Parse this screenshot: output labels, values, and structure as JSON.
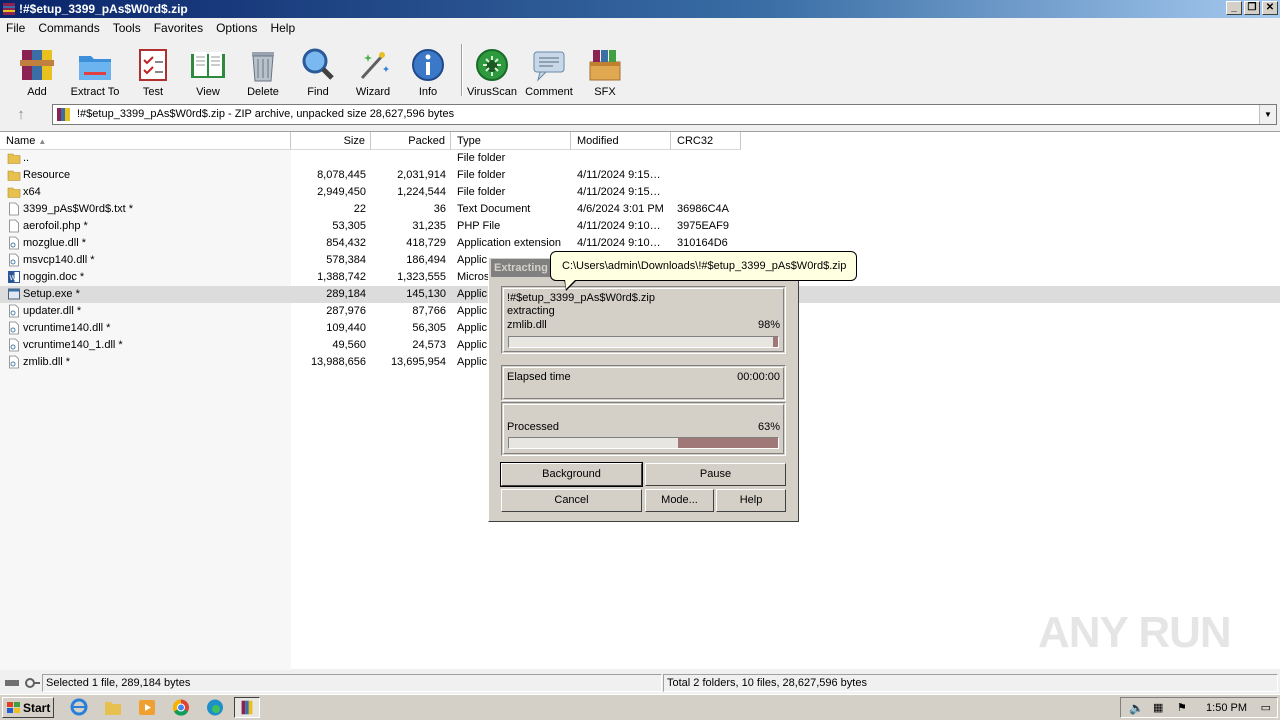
{
  "window": {
    "title": "!#$etup_3399_pAs$W0rd$.zip",
    "controls": [
      "_",
      "❐",
      "✕"
    ]
  },
  "menu": [
    "File",
    "Commands",
    "Tools",
    "Favorites",
    "Options",
    "Help"
  ],
  "toolbar": [
    {
      "label": "Add",
      "icon": "add-archive-icon"
    },
    {
      "label": "Extract To",
      "icon": "extract-folder-icon"
    },
    {
      "label": "Test",
      "icon": "test-checklist-icon"
    },
    {
      "label": "View",
      "icon": "view-book-icon"
    },
    {
      "label": "Delete",
      "icon": "trash-icon"
    },
    {
      "label": "Find",
      "icon": "magnifier-icon"
    },
    {
      "label": "Wizard",
      "icon": "wand-icon"
    },
    {
      "label": "Info",
      "icon": "info-icon"
    },
    {
      "label": "VirusScan",
      "icon": "virus-icon"
    },
    {
      "label": "Comment",
      "icon": "comment-icon"
    },
    {
      "label": "SFX",
      "icon": "sfx-box-icon"
    }
  ],
  "address": {
    "text": "!#$etup_3399_pAs$W0rd$.zip - ZIP archive, unpacked size 28,627,596 bytes"
  },
  "columns": [
    "Name",
    "Size",
    "Packed",
    "Type",
    "Modified",
    "CRC32"
  ],
  "files": [
    {
      "name": "..",
      "size": "",
      "packed": "",
      "type": "File folder",
      "modified": "",
      "crc": "",
      "icon": "folder"
    },
    {
      "name": "Resource",
      "size": "8,078,445",
      "packed": "2,031,914",
      "type": "File folder",
      "modified": "4/11/2024 9:15…",
      "crc": "",
      "icon": "folder"
    },
    {
      "name": "x64",
      "size": "2,949,450",
      "packed": "1,224,544",
      "type": "File folder",
      "modified": "4/11/2024 9:15…",
      "crc": "",
      "icon": "folder"
    },
    {
      "name": "3399_pAs$W0rd$.txt *",
      "size": "22",
      "packed": "36",
      "type": "Text Document",
      "modified": "4/6/2024 3:01 PM",
      "crc": "36986C4A",
      "icon": "doc"
    },
    {
      "name": "aerofoil.php *",
      "size": "53,305",
      "packed": "31,235",
      "type": "PHP File",
      "modified": "4/11/2024 9:10…",
      "crc": "3975EAF9",
      "icon": "doc"
    },
    {
      "name": "mozglue.dll *",
      "size": "854,432",
      "packed": "418,729",
      "type": "Application extension",
      "modified": "4/11/2024 9:10…",
      "crc": "310164D6",
      "icon": "dll"
    },
    {
      "name": "msvcp140.dll *",
      "size": "578,384",
      "packed": "186,494",
      "type": "Applic",
      "modified": "",
      "crc": "",
      "icon": "dll"
    },
    {
      "name": "noggin.doc *",
      "size": "1,388,742",
      "packed": "1,323,555",
      "type": "Micros",
      "modified": "",
      "crc": "",
      "icon": "word"
    },
    {
      "name": "Setup.exe *",
      "size": "289,184",
      "packed": "145,130",
      "type": "Applic",
      "modified": "",
      "crc": "",
      "icon": "exe",
      "selected": true
    },
    {
      "name": "updater.dll *",
      "size": "287,976",
      "packed": "87,766",
      "type": "Applic",
      "modified": "",
      "crc": "",
      "icon": "dll"
    },
    {
      "name": "vcruntime140.dll *",
      "size": "109,440",
      "packed": "56,305",
      "type": "Applic",
      "modified": "",
      "crc": "",
      "icon": "dll"
    },
    {
      "name": "vcruntime140_1.dll *",
      "size": "49,560",
      "packed": "24,573",
      "type": "Applic",
      "modified": "",
      "crc": "",
      "icon": "dll"
    },
    {
      "name": "zmlib.dll *",
      "size": "13,988,656",
      "packed": "13,695,954",
      "type": "Applic",
      "modified": "",
      "crc": "",
      "icon": "dll"
    }
  ],
  "status": {
    "left": "Selected 1 file, 289,184 bytes",
    "right": "Total 2 folders, 10 files, 28,627,596 bytes"
  },
  "taskbar": {
    "start": "Start",
    "clock": "1:50 PM",
    "apps": [
      "ie-icon",
      "explorer-icon",
      "media-player-icon",
      "chrome-icon",
      "edge-icon",
      "winrar-icon"
    ]
  },
  "dialog": {
    "title": "Extracting",
    "archive": "!#$etup_3399_pAs$W0rd$.zip",
    "action": "extracting",
    "current_file": "zmlib.dll",
    "file_percent_text": "98%",
    "file_progress": 0.98,
    "elapsed_label": "Elapsed time",
    "elapsed_value": "00:00:00",
    "processed_label": "Processed",
    "processed_percent_text": "63%",
    "processed_progress": 0.63,
    "buttons": {
      "background": "Background",
      "pause": "Pause",
      "cancel": "Cancel",
      "mode": "Mode...",
      "help": "Help"
    }
  },
  "tooltip": "C:\\Users\\admin\\Downloads\\!#$etup_3399_pAs$W0rd$.zip",
  "watermark": "ANY RUN",
  "colors": {
    "progress_fill": "#a07878",
    "selection": "#dcdcdc",
    "tooltip_bg": "#ffffe1"
  }
}
